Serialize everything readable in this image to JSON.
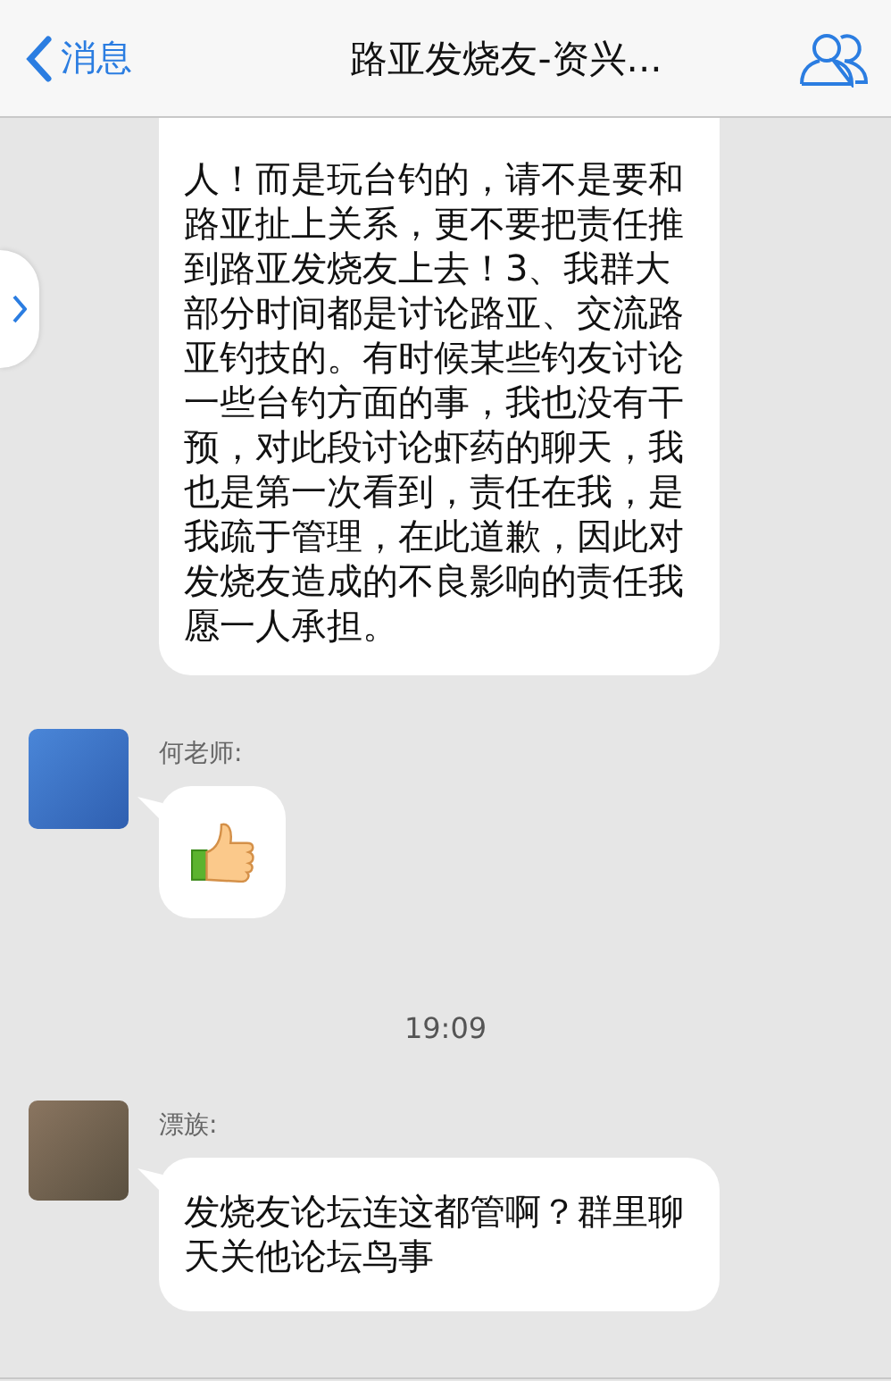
{
  "header": {
    "back_label": "消息",
    "title": "路亚发烧友-资兴..."
  },
  "messages": [
    {
      "kind": "text",
      "continued": true,
      "text": "人！而是玩台钓的，请不是要和路亚扯上关系，更不要把责任推到路亚发烧友上去！3、我群大部分时间都是讨论路亚、交流路亚钓技的。有时候某些钓友讨论一些台钓方面的事，我也没有干预，对此段讨论虾药的聊天，我也是第一次看到，责任在我，是我疏于管理，在此道歉，因此对发烧友造成的不良影响的责任我愿一人承担。"
    },
    {
      "kind": "sticker",
      "sender": "何老师:"
    },
    {
      "kind": "time",
      "text": "19:09"
    },
    {
      "kind": "text",
      "sender": "漂族:",
      "text": "发烧友论坛连这都管啊？群里聊天关他论坛鸟事"
    }
  ]
}
